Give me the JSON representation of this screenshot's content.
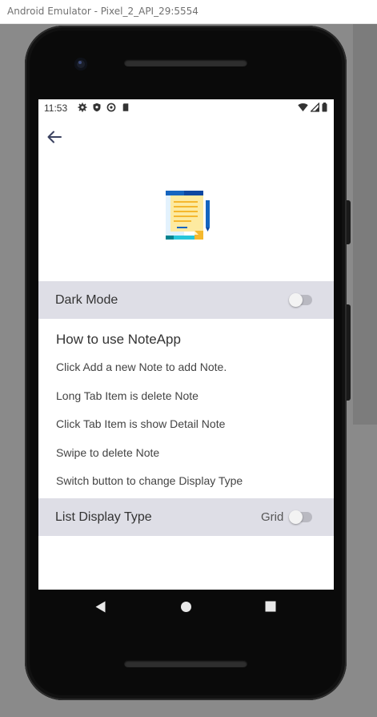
{
  "window": {
    "title": "Android Emulator - Pixel_2_API_29:5554"
  },
  "status_bar": {
    "time": "11:53"
  },
  "header": {
    "back_icon": "arrow-left-icon"
  },
  "app_logo": {
    "icon": "notes-document-icon"
  },
  "dark_mode": {
    "label": "Dark Mode",
    "enabled": false
  },
  "how_to": {
    "title": "How to use NoteApp",
    "items": [
      "Click Add a new Note to add Note.",
      "Long Tab Item is delete Note",
      "Click Tab Item is show Detail Note",
      "Swipe to delete Note",
      "Switch button to change Display Type"
    ]
  },
  "display_type": {
    "label": "List Display Type",
    "value_label": "Grid",
    "enabled": false
  },
  "nav": {
    "back": "back-triangle-icon",
    "home": "home-circle-icon",
    "recents": "recents-square-icon"
  },
  "colors": {
    "row_background": "#dedee6",
    "accent": "#1565c0",
    "text": "#333333"
  }
}
